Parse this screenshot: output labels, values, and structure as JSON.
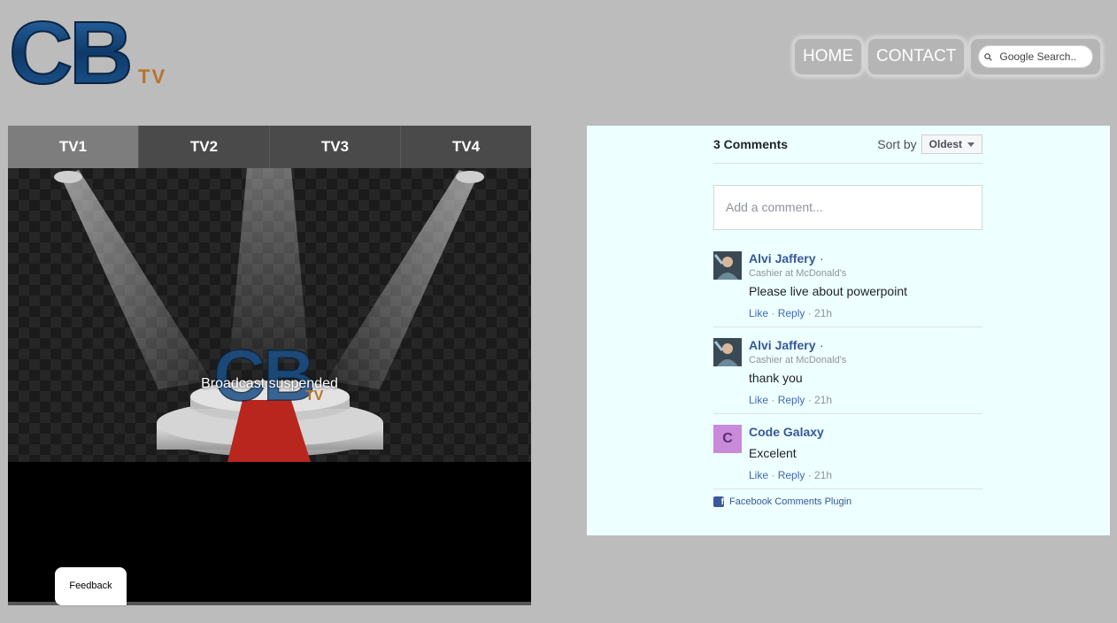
{
  "logo": {
    "letters": "CB",
    "suffix": "TV"
  },
  "nav": {
    "home": "HOME",
    "contact": "CONTACT",
    "search_placeholder": "Google Search.."
  },
  "player": {
    "tabs": [
      "TV1",
      "TV2",
      "TV3",
      "TV4"
    ],
    "active_tab": "TV1",
    "status": "Broadcast suspended"
  },
  "feedback": "Feedback",
  "comments": {
    "count_label": "3 Comments",
    "sort_label": "Sort by",
    "sort_value": "Oldest",
    "add_placeholder": "Add a comment...",
    "items": [
      {
        "author": "Alvi Jaffery",
        "sep": "·",
        "subtitle": "Cashier at McDonald's",
        "text": "Please live about powerpoint",
        "like": "Like",
        "reply": "Reply",
        "time": "21h"
      },
      {
        "author": "Alvi Jaffery",
        "sep": "·",
        "subtitle": "Cashier at McDonald's",
        "text": "thank you",
        "like": "Like",
        "reply": "Reply",
        "time": "21h"
      },
      {
        "author": "Code Galaxy",
        "initial": "C",
        "text": "Excelent",
        "like": "Like",
        "reply": "Reply",
        "time": "21h"
      }
    ],
    "plugin_label": "Facebook Comments Plugin",
    "plugin_icon": "f"
  },
  "colors": {
    "link": "#365899",
    "panel_bg": "#edfffe",
    "page_bg": "#bbbcbb",
    "active_tab": "#7d7d7d"
  }
}
